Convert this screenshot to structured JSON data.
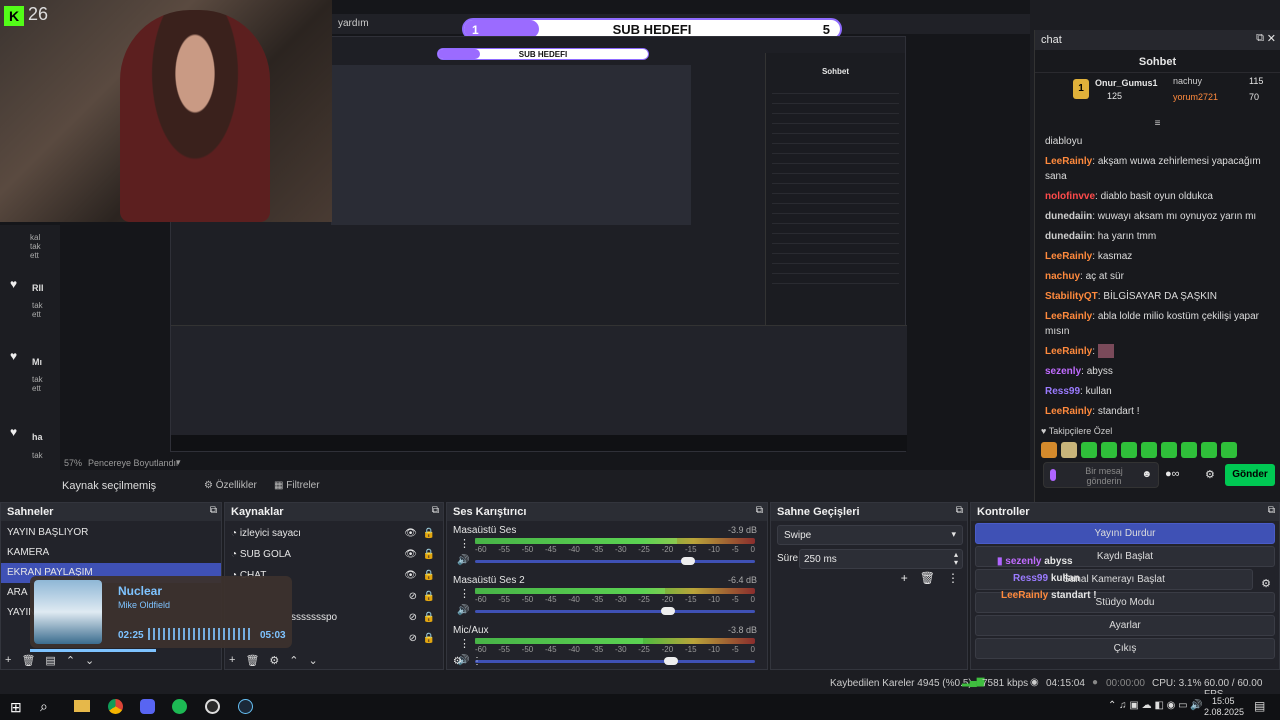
{
  "goal": {
    "label": "SUB HEDEFI",
    "current": "1",
    "target": "5",
    "fill_fraction": 0.2
  },
  "menu": {
    "help_fragment": "yardım"
  },
  "webcam": {
    "badge": "26"
  },
  "preview": {
    "zoom_label": "57%",
    "fit_label": "Pencereye Boyutlandır",
    "no_source": "Kaynak seçilmemiş",
    "props_btn": "Özellikler",
    "filters_btn": "Filtreler"
  },
  "left_strip": {
    "items": [
      {
        "heart": true,
        "text": "kal tak ett"
      },
      {
        "heart": true,
        "text": "RII tak ett"
      },
      {
        "heart": true,
        "text": "Mı tak ett"
      },
      {
        "heart": true,
        "text": "ha tak ett"
      }
    ]
  },
  "chat_window": {
    "title": "chat",
    "header": "Sohbet"
  },
  "chat": {
    "leaderboard": [
      {
        "rank": "1",
        "name": "Onur_Gumus1",
        "value": "125"
      },
      {
        "name": "nachuy",
        "value": "115"
      },
      {
        "name": "yorum2721",
        "value": "70"
      }
    ],
    "messages": [
      {
        "user": "",
        "color": "#dddddd",
        "text": "diabloyu"
      },
      {
        "user": "LeeRainly",
        "color": "#ff8a3d",
        "text": "akşam wuwa zehirlemesi yapacağım sana"
      },
      {
        "user": "nolofinvve",
        "color": "#ff4b4b",
        "text": "diablo basit oyun oldukca"
      },
      {
        "user": "dunedaiin",
        "color": "#cfcfcf",
        "text": "wuwayı aksam mı oynuyoz yarın mı"
      },
      {
        "user": "dunedaiin",
        "color": "#cfcfcf",
        "text": "ha yarın tmm"
      },
      {
        "user": "LeeRainly",
        "color": "#ff8a3d",
        "text": "kasmaz"
      },
      {
        "user": "nachuy",
        "color": "#ff8a3d",
        "text": "aç at sür"
      },
      {
        "user": "StabilityQT",
        "color": "#ff8a3d",
        "text": "BİLGİSAYAR DA ŞAŞKIN"
      },
      {
        "user": "LeeRainly",
        "color": "#ff8a3d",
        "text": "abla lolde milio kostüm çekilişi yapar mısın"
      },
      {
        "user": "LeeRainly",
        "color": "#ff8a3d",
        "text": ""
      },
      {
        "user": "sezenly",
        "color": "#c06bff",
        "text": "abyss"
      },
      {
        "user": "Ress99",
        "color": "#9b7bff",
        "text": "kullan"
      },
      {
        "user": "LeeRainly",
        "color": "#ff8a3d",
        "text": "standart !"
      }
    ],
    "emote_label": "Takipçilere Özel",
    "input_placeholder": "Bir mesaj gönderin",
    "send_label": "Gönder",
    "infinity": "∞"
  },
  "scenes": {
    "title": "Sahneler",
    "items": [
      "YAYIN BAŞLIYOR",
      "KAMERA",
      "EKRAN PAYLAŞIM",
      "ARA",
      "YAYIN"
    ],
    "selected_index": 2
  },
  "sources": {
    "title": "Kaynaklar",
    "items": [
      "izleyici sayacı",
      "SUB GOLA",
      "CHAT",
      "",
      "ssssssspo",
      ""
    ]
  },
  "player": {
    "title": "Nuclear",
    "artist": "Mike Oldfield",
    "elapsed": "02:25",
    "total": "05:03",
    "progress": 0.48
  },
  "mixer": {
    "title": "Ses Karıştırıcı",
    "channels": [
      {
        "name": "Masaüstü Ses",
        "db": "-3.9 dB",
        "level": 0.72,
        "volume": 0.76
      },
      {
        "name": "Masaüstü Ses 2",
        "db": "-6.4 dB",
        "level": 0.68,
        "volume": 0.69
      },
      {
        "name": "Mic/Aux",
        "db": "-3.8 dB",
        "level": 0.6,
        "volume": 0.7
      }
    ],
    "ticks": [
      "-60",
      "-55",
      "-50",
      "-45",
      "-40",
      "-35",
      "-30",
      "-25",
      "-20",
      "-15",
      "-10",
      "-5",
      "0"
    ]
  },
  "transitions": {
    "title": "Sahne Geçişleri",
    "selected": "Swipe",
    "duration_label": "Süre",
    "duration_value": "250 ms"
  },
  "controls": {
    "title": "Kontroller",
    "buttons": [
      "Yayını Durdur",
      "Kaydı Başlat",
      "Sanal Kamerayı Başlat",
      "Stüdyo Modu",
      "Ayarlar",
      "Çıkış"
    ],
    "overlay_alerts": [
      {
        "user": "sezenly",
        "text": "abyss"
      },
      {
        "user": "Ress99",
        "text": "kullan"
      },
      {
        "user": "LeeRainly",
        "text": "standart !"
      }
    ]
  },
  "status": {
    "dropped": "Kaybedilen Kareler 4945 (%0.5)",
    "kbps": "7581 kbps",
    "live_time": "04:15:04",
    "rec_time": "00:00:00",
    "cpu": "CPU: 3.1%",
    "fps": "60.00 / 60.00 FPS"
  },
  "taskbar": {
    "time": "15:05",
    "date": "2.08.2025"
  },
  "colors": {
    "accent_blue": "#3f51b5",
    "send_green": "#00c853",
    "goal_purple": "#9b6bff",
    "orange_user": "#ff8a3d"
  }
}
